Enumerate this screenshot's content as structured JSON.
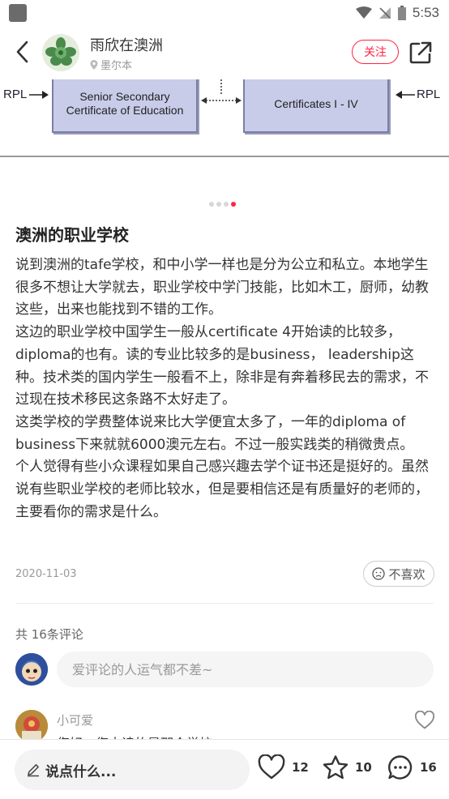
{
  "status_bar": {
    "time": "5:53"
  },
  "header": {
    "author": "雨欣在澳洲",
    "location": "墨尔本",
    "follow_label": "关注"
  },
  "carousel": {
    "left_rpl": "RPL",
    "right_rpl": "RPL",
    "left_box": "Senior Secondary Certificate of Education",
    "right_box": "Certificates I - IV",
    "dot_count": 4,
    "active_dot": 3
  },
  "post": {
    "title": "澳洲的职业学校",
    "paragraphs": [
      "说到澳洲的tafe学校，和中小学一样也是分为公立和私立。本地学生很多不想让大学就去，职业学校中学门技能，比如木工，厨师，幼教这些，出来也能找到不错的工作。",
      "这边的职业学校中国学生一般从certificate 4开始读的比较多，diploma的也有。读的专业比较多的是business， leadership这种。技术类的国内学生一般看不上，除非是有奔着移民去的需求，不过现在技术移民这条路不太好走了。",
      "这类学校的学费整体说来比大学便宜太多了，一年的diploma of business下来就就6000澳元左右。不过一般实践类的稍微贵点。",
      "个人觉得有些小众课程如果自己感兴趣去学个证书还是挺好的。虽然说有些职业学校的老师比较水，但是要相信还是有质量好的老师的，主要看你的需求是什么。"
    ],
    "date": "2020-11-03",
    "dislike_label": "不喜欢"
  },
  "comments": {
    "count_label": "共 16条评论",
    "input_placeholder": "爱评论的人运气都不差~",
    "first": {
      "user": "小可爱",
      "text": "您好，您去读的是那个学校"
    }
  },
  "bottom_bar": {
    "say_label": "说点什么...",
    "likes": "12",
    "stars": "10",
    "comments": "16"
  },
  "colors": {
    "accent": "#ff2442",
    "diagram_box": "#c8cce8"
  }
}
